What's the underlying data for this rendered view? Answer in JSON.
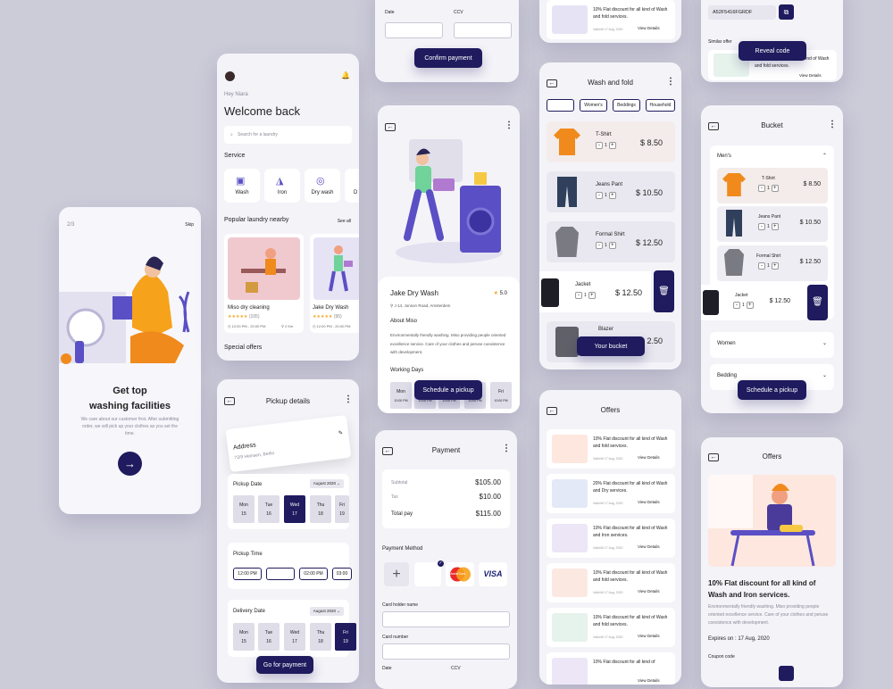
{
  "onboard": {
    "step": "2/3",
    "skip": "Skip",
    "title_line1": "Get top",
    "title_line2": "washing facilities",
    "desc": "We care about our customer first. After submitting order, we will pick up your clothes as you set the time."
  },
  "home": {
    "greeting": "Hey Niara",
    "title": "Welcome back",
    "search_placeholder": "Search for a laundry",
    "service_label": "Service",
    "services": [
      "Wash",
      "Iron",
      "Dry wash",
      "D"
    ],
    "popular_label": "Popular laundry nearby",
    "see_all": "See all",
    "laundries": [
      {
        "name": "Miso dry cleaning",
        "count": "(105)",
        "time": "12:00 PM - 20:00 PM",
        "dist": "2 Km"
      },
      {
        "name": "Jake Dry Wash",
        "count": "(95)",
        "time": "12:00 PM - 20:00 PM"
      }
    ],
    "special": "Special offers"
  },
  "pickup": {
    "title": "Pickup details",
    "address_label": "Address",
    "address_value": "72/9 Heinsen, Berlin",
    "date_label": "Pickup Date",
    "date_month": "August 2020",
    "days": [
      {
        "d": "Mon",
        "n": "15"
      },
      {
        "d": "Tue",
        "n": "16"
      },
      {
        "d": "Wed",
        "n": "17"
      },
      {
        "d": "Thu",
        "n": "18"
      },
      {
        "d": "Fri",
        "n": "19"
      }
    ],
    "time_label": "Pickup Time",
    "times": [
      "12:00 PM",
      "01:00 PM",
      "02:00 PM",
      "03:00"
    ],
    "delivery_label": "Delivery Date",
    "delivery_month": "August 2020",
    "ddays": [
      {
        "d": "Mon",
        "n": "15"
      },
      {
        "d": "Tue",
        "n": "16"
      },
      {
        "d": "Wed",
        "n": "17"
      },
      {
        "d": "Thu",
        "n": "18"
      },
      {
        "d": "Fri",
        "n": "19"
      }
    ],
    "button": "Go for payment"
  },
  "topPay": {
    "date": "Date",
    "ccv": "CCV",
    "button": "Confirm payment"
  },
  "shop": {
    "name": "Jake Dry Wash",
    "rating": "5.0",
    "address": "J 14, Jonson Road, Amsterdem",
    "about_label": "About Miso",
    "about": "Environmentally friendly washing. Miso providing people oriented excellence service. Care of your clothes and peruse coexistence with development.",
    "working": "Working Days",
    "wdays": [
      {
        "d": "Mon",
        "t": "10:00 PM"
      },
      {
        "d": "",
        "t": "10:00 PM"
      },
      {
        "d": "",
        "t": "10:00 PM"
      },
      {
        "d": "",
        "t": "10:00 PM"
      },
      {
        "d": "Fri",
        "t": "10:00 PM"
      }
    ],
    "button": "Schedule a pickup"
  },
  "payment": {
    "title": "Payment",
    "subtotal_label": "Subtotal",
    "subtotal": "$105.00",
    "tax_label": "Tax",
    "tax": "$10.00",
    "total_label": "Total pay",
    "total": "$115.00",
    "method_label": "Payment Method",
    "mc": "MasterCard",
    "visa": "VISA",
    "holder_label": "Card holder name",
    "number_label": "Card number",
    "date": "Date",
    "ccv": "CCV"
  },
  "topOffer": {
    "text": "10% Flat discount for all kind of Wash and fold services.",
    "valid": "Valid till 17 Aug, 2020",
    "details": "View Details"
  },
  "wash": {
    "title": "Wash and fold",
    "tabs": [
      "Men's",
      "Women's",
      "Beddings",
      "Household"
    ],
    "items": [
      {
        "name": "T-Shirt",
        "price": "$ 8.50",
        "q": "1"
      },
      {
        "name": "Jeans Pant",
        "price": "$ 10.50",
        "q": "1"
      },
      {
        "name": "Formal Shirt",
        "price": "$ 12.50",
        "q": "1"
      },
      {
        "name": "Jacket",
        "price": "$ 12.50",
        "q": "1"
      },
      {
        "name": "Blazer",
        "price": "2.50"
      }
    ],
    "button": "Your bucket"
  },
  "offers": {
    "title": "Offers",
    "list": [
      {
        "text": "10% Flat discount for all kind of Wash and fold services.",
        "valid": "Valid till 17 Aug, 2020",
        "details": "View Details"
      },
      {
        "text": "20% Flat discount for all kind of Wash and Dry services.",
        "valid": "Valid till 17 Aug, 2020",
        "details": "View Details"
      },
      {
        "text": "10% Flat discount for all kind of Wash and Iron services.",
        "valid": "Valid till 17 Aug, 2020",
        "details": "View Details"
      },
      {
        "text": "10% Flat discount for all kind of Wash and fold services.",
        "valid": "Valid till 17 Aug, 2020",
        "details": "View Details"
      },
      {
        "text": "10% Flat discount for all kind of Wash and fold services.",
        "valid": "Valid till 17 Aug, 2020",
        "details": "View Details"
      },
      {
        "text": "10% Flat discount for all kind of",
        "valid": "",
        "details": "View Details"
      }
    ]
  },
  "coupon": {
    "code": "A52F5416FGRDF",
    "similar": "Similar offer",
    "button": "Reveal code",
    "offer_text": "10% Flat discount for all kind of Wash and fold services.",
    "details": "View Details"
  },
  "bucket": {
    "title": "Bucket",
    "men": "Men's",
    "items": [
      {
        "name": "T-Shirt",
        "price": "$ 8.50",
        "q": "1"
      },
      {
        "name": "Jeans Pant",
        "price": "$ 10.50",
        "q": "1"
      },
      {
        "name": "Formal Shirt",
        "price": "$ 12.50",
        "q": "1"
      },
      {
        "name": "Jacket",
        "price": "$ 12.50",
        "q": "1"
      }
    ],
    "women": "Women",
    "bedding": "Bedding",
    "button": "Schedule a pickup"
  },
  "offerDetail": {
    "title": "Offers",
    "headline": "10% Flat discount for all kind of Wash and Iron services.",
    "desc": "Environmentally friendly washing. Miso providing people oriented excellence service. Care of your clothes and peruse coexistence with development.",
    "expires": "Expires on : 17 Aug, 2020",
    "coupon": "Coupon code"
  },
  "colors": {
    "navy": "#1f1b5e",
    "orange": "#f08a1c",
    "bg": "#cccbd8"
  }
}
